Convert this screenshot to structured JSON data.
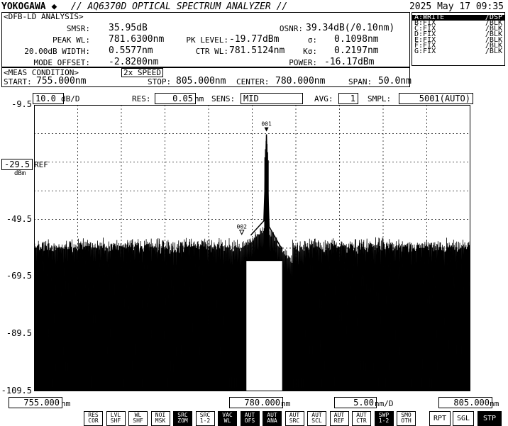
{
  "header": {
    "brand": "YOKOGAWA",
    "brand_mark": "◆",
    "model": "// AQ6370D OPTICAL SPECTRUM ANALYZER //",
    "datetime": "2025 May 17 09:35"
  },
  "analysis": {
    "title": "<DFB-LD ANALYSIS>",
    "smsr_label": "SMSR:",
    "smsr": "35.95dB",
    "peak_wl_label": "PEAK WL:",
    "peak_wl": "781.6300nm",
    "width_label": "20.00dB WIDTH:",
    "width": "0.5577nm",
    "mode_offset_label": "MODE OFFSET:",
    "mode_offset": "-2.8200nm",
    "osnr_label": "OSNR:",
    "osnr": "39.34dB(/0.10nm)",
    "pk_level_label": "PK LEVEL:",
    "pk_level": "-19.77dBm",
    "sigma_label": "σ:",
    "sigma": "0.1098nm",
    "ctr_wl_label": "CTR WL:",
    "ctr_wl": "781.5124nm",
    "ksigma_label": "Kσ:",
    "ksigma": "0.2197nm",
    "power_label": "POWER:",
    "power": "-16.17dBm"
  },
  "traces": [
    {
      "name": "A:WRITE",
      "mode": "/DSP",
      "selected": true
    },
    {
      "name": "B:FIX",
      "mode": "/BLK"
    },
    {
      "name": "C:FIX",
      "mode": "/BLK"
    },
    {
      "name": "D:FIX",
      "mode": "/BLK"
    },
    {
      "name": "E:FIX",
      "mode": "/BLK"
    },
    {
      "name": "F:FIX",
      "mode": "/BLK"
    },
    {
      "name": "G:FIX",
      "mode": "/BLK"
    }
  ],
  "meas": {
    "title": "<MEAS CONDITION>",
    "speed": "2x SPEED",
    "start_label": "START:",
    "start": "755.000nm",
    "stop_label": "STOP:",
    "stop": "805.000nm",
    "center_label": "CENTER:",
    "center": "780.000nm",
    "span_label": "SPAN:",
    "span": "50.0nm"
  },
  "settings": {
    "scale": "10.0",
    "scale_unit": "dB/D",
    "res_label": "RES:",
    "res": "0.05",
    "res_unit": "nm",
    "sens_label": "SENS:",
    "sens": "MID",
    "avg_label": "AVG:",
    "avg": "1",
    "smpl_label": "SMPL:",
    "smpl": "5001(AUTO)"
  },
  "ref": {
    "value": "-29.5",
    "label": "REF",
    "unit": "dBm"
  },
  "chart_data": {
    "type": "line",
    "x_range": [
      755.0,
      805.0
    ],
    "y_range": [
      -109.5,
      -9.5
    ],
    "yticks": [
      "-9.5",
      "-29.5",
      "-49.5",
      "-69.5",
      "-89.5",
      "-109.5"
    ],
    "peak_x": 781.63,
    "peak_y": -19.77,
    "markers": [
      {
        "label": "001",
        "x": 781.63,
        "y": -19.8
      },
      {
        "label": "002",
        "x": 778.8,
        "y": -55.7
      }
    ]
  },
  "bottom": {
    "start": "755.000",
    "start_unit": "nm",
    "center": "780.000",
    "center_unit": "nm",
    "span_div": "5.00",
    "span_div_unit": "nm/D",
    "stop": "805.000",
    "stop_unit": "nm"
  },
  "softkeys": [
    {
      "l1": "RES",
      "l2": "COR",
      "inv": false
    },
    {
      "l1": "LVL",
      "l2": "SHF",
      "inv": false
    },
    {
      "l1": "WL",
      "l2": "SHF",
      "inv": false
    },
    {
      "l1": "NOI",
      "l2": "MSK",
      "inv": false
    },
    {
      "l1": "SRC",
      "l2": "ZOM",
      "inv": true
    },
    {
      "l1": "SRC",
      "l2": "1-2",
      "inv": false
    },
    {
      "l1": "VAC",
      "l2": "WL",
      "inv": true
    },
    {
      "l1": "AUT",
      "l2": "OFS",
      "inv": true
    },
    {
      "l1": "AUT",
      "l2": "ANA",
      "inv": true
    },
    {
      "l1": "AUT",
      "l2": "SRC",
      "inv": false
    },
    {
      "l1": "AUT",
      "l2": "SCL",
      "inv": false
    },
    {
      "l1": "AUT",
      "l2": "REF",
      "inv": false
    },
    {
      "l1": "AUT",
      "l2": "CTR",
      "inv": false
    },
    {
      "l1": "SWP",
      "l2": "1-2",
      "inv": true
    },
    {
      "l1": "SMO",
      "l2": "OTH",
      "inv": false
    }
  ],
  "buttons": {
    "rpt": "RPT",
    "sgl": "SGL",
    "stp": "STP"
  }
}
